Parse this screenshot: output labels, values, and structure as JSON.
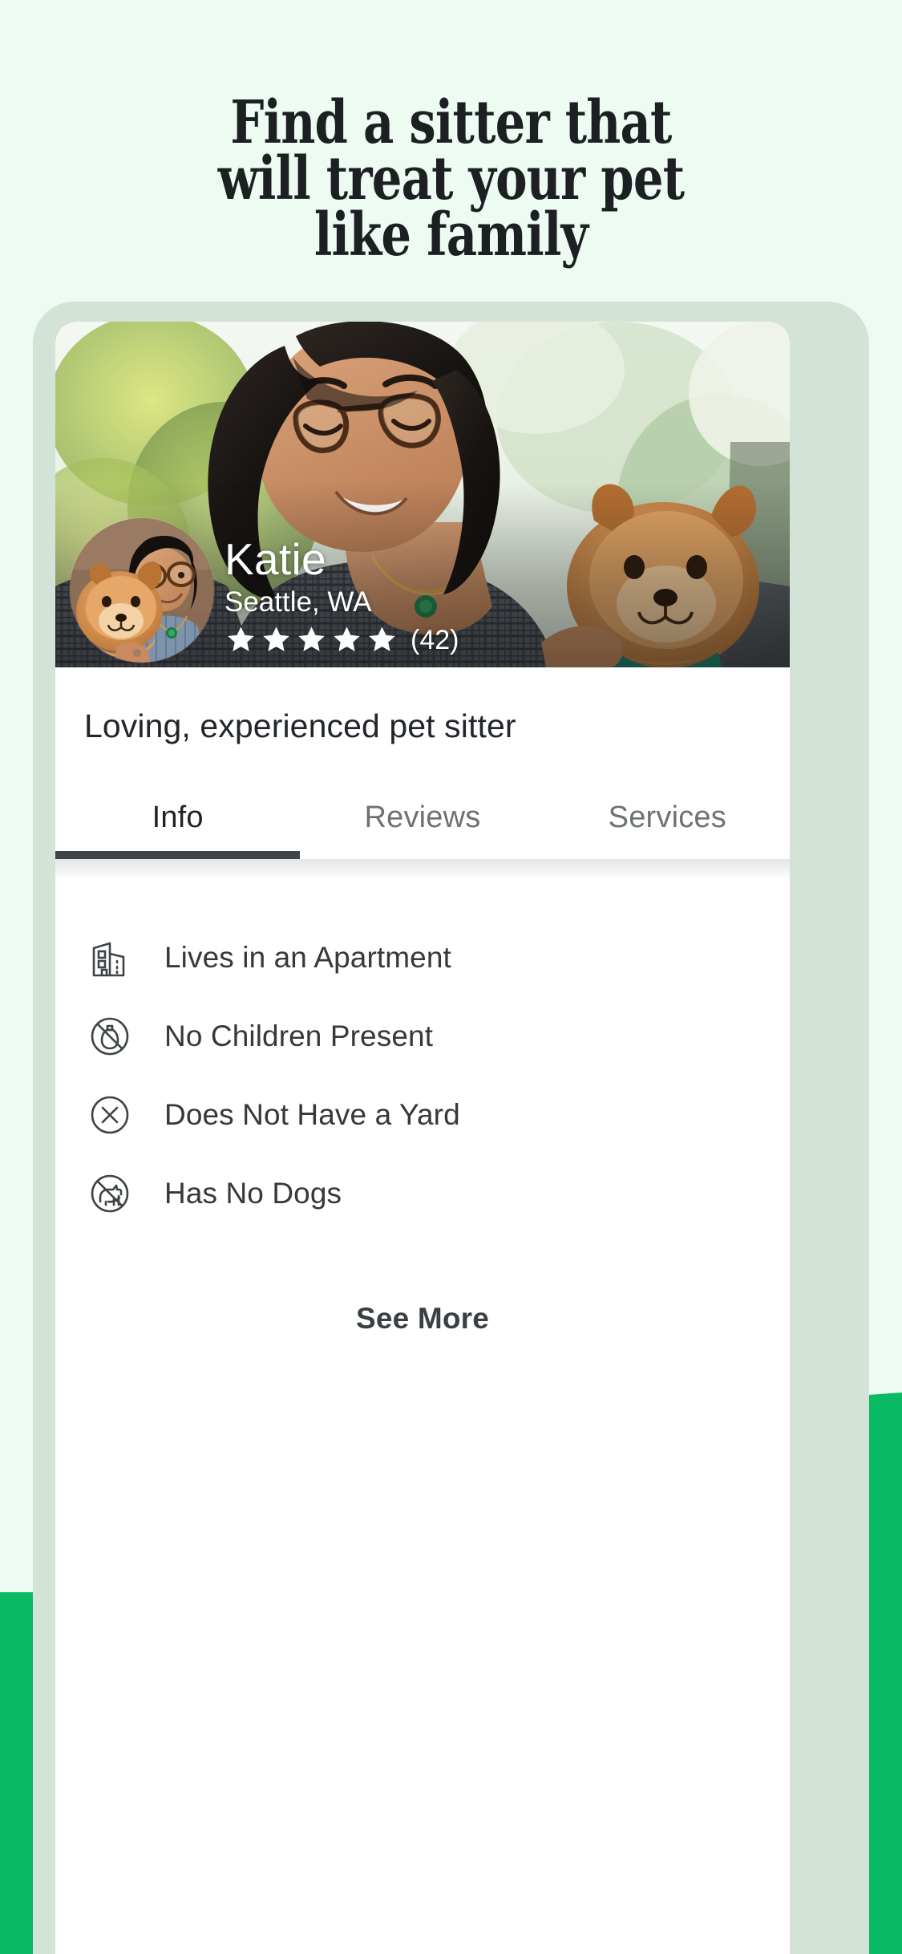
{
  "theme": {
    "background": "#edfbf2",
    "accent_green": "#0ab964",
    "phone_frame": "#d3e3d7",
    "screen": "#ffffff",
    "text_dark": "#1c2022",
    "text_muted": "#6d7275",
    "tab_underline": "#3f4447"
  },
  "headline": {
    "line1": "Find a sitter that",
    "line2": "will treat your pet",
    "line3": "like family"
  },
  "profile": {
    "name": "Katie",
    "location": "Seattle, WA",
    "stars": 5,
    "review_count": "(42)",
    "tagline": "Loving, experienced pet sitter",
    "avatar_name": "sitter-avatar"
  },
  "tabs": [
    {
      "label": "Info",
      "active": true
    },
    {
      "label": "Reviews",
      "active": false
    },
    {
      "label": "Services",
      "active": false
    }
  ],
  "info_items": [
    {
      "icon": "apartment-building-icon",
      "label": "Lives in an Apartment"
    },
    {
      "icon": "no-children-icon",
      "label": "No Children Present"
    },
    {
      "icon": "no-yard-icon",
      "label": "Does Not Have a Yard"
    },
    {
      "icon": "no-dogs-icon",
      "label": "Has No Dogs"
    }
  ],
  "actions": {
    "see_more": "See More"
  }
}
